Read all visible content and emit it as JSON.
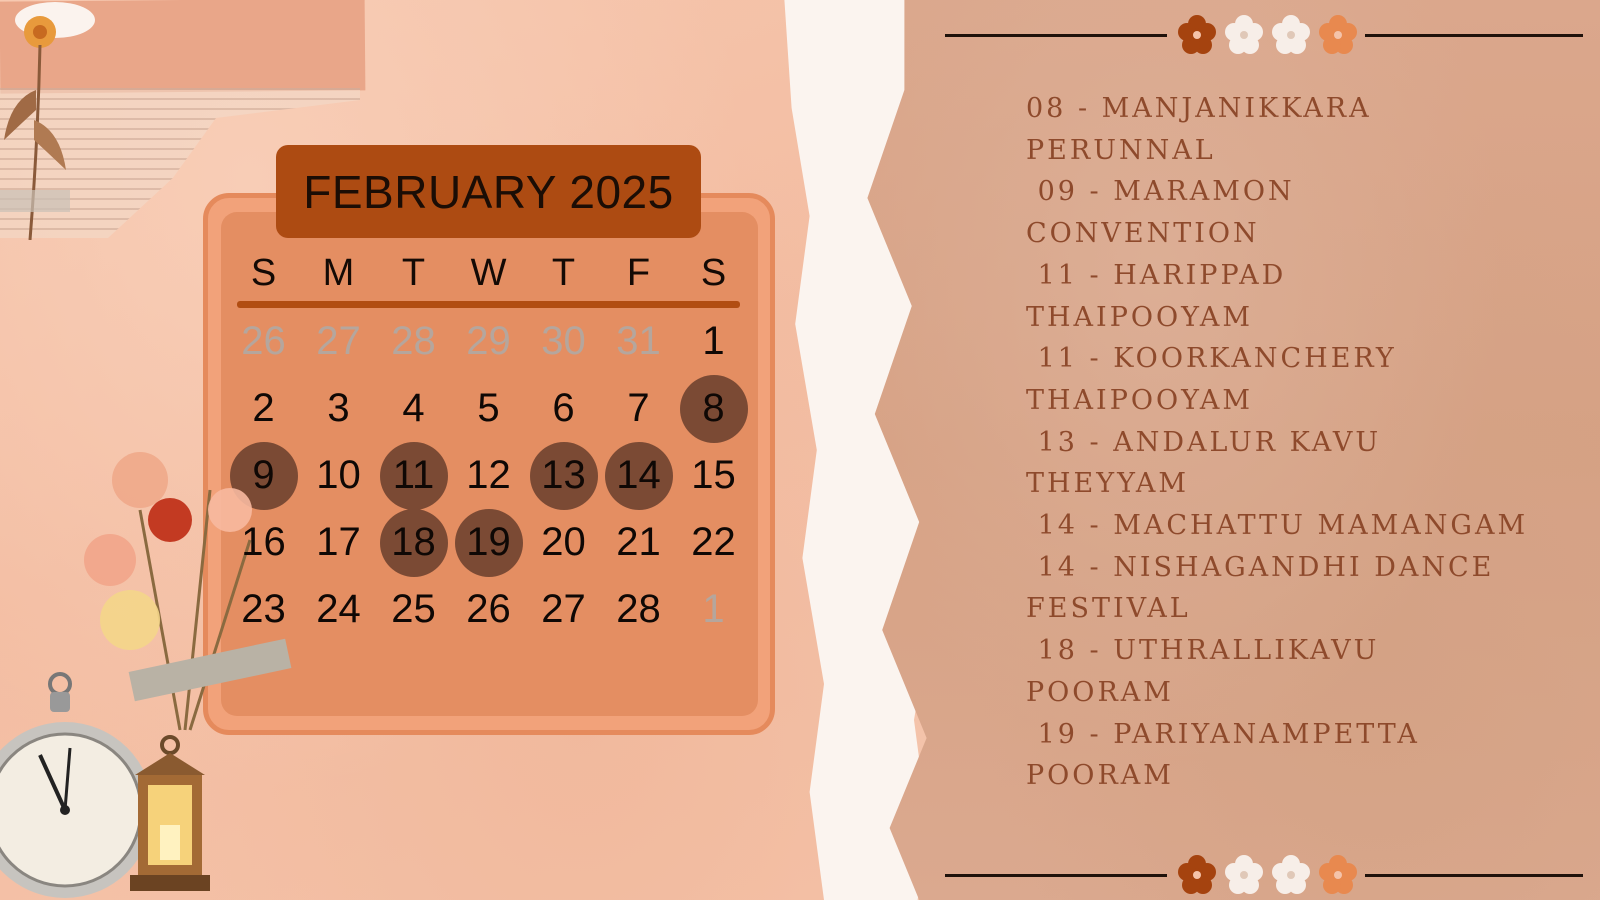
{
  "calendar": {
    "title": "FEBRUARY 2025",
    "weekdays": [
      "S",
      "M",
      "T",
      "W",
      "T",
      "F",
      "S"
    ],
    "highlighted_days": [
      8,
      9,
      11,
      13,
      14,
      18,
      19
    ],
    "highlight_color": "#7b4a34",
    "weeks": [
      [
        {
          "d": "26",
          "m": true
        },
        {
          "d": "27",
          "m": true
        },
        {
          "d": "28",
          "m": true
        },
        {
          "d": "29",
          "m": true
        },
        {
          "d": "30",
          "m": true
        },
        {
          "d": "31",
          "m": true
        },
        {
          "d": "1"
        }
      ],
      [
        {
          "d": "2"
        },
        {
          "d": "3"
        },
        {
          "d": "4"
        },
        {
          "d": "5"
        },
        {
          "d": "6"
        },
        {
          "d": "7"
        },
        {
          "d": "8",
          "h": true
        }
      ],
      [
        {
          "d": "9",
          "h": true
        },
        {
          "d": "10"
        },
        {
          "d": "11",
          "h": true
        },
        {
          "d": "12"
        },
        {
          "d": "13",
          "h": true
        },
        {
          "d": "14",
          "h": true
        },
        {
          "d": "15"
        }
      ],
      [
        {
          "d": "16"
        },
        {
          "d": "17"
        },
        {
          "d": "18",
          "h": true
        },
        {
          "d": "19",
          "h": true
        },
        {
          "d": "20"
        },
        {
          "d": "21"
        },
        {
          "d": "22"
        }
      ],
      [
        {
          "d": "23"
        },
        {
          "d": "24"
        },
        {
          "d": "25"
        },
        {
          "d": "26"
        },
        {
          "d": "27"
        },
        {
          "d": "28"
        },
        {
          "d": "1",
          "m": true
        }
      ]
    ]
  },
  "events": [
    "08 - MANJANIKKARA",
    "PERUNNAL",
    " 09 - MARAMON",
    "CONVENTION",
    " 11 - HARIPPAD",
    "THAIPOOYAM",
    " 11 - KOORKANCHERY",
    "THAIPOOYAM",
    " 13 - ANDALUR KAVU",
    "THEYYAM",
    " 14 - MACHATTU MAMANGAM",
    " 14 - NISHAGANDHI DANCE",
    "FESTIVAL",
    " 18 - UTHRALLIKAVU",
    "POORAM",
    " 19 - PARIYANAMPETTA",
    "POORAM"
  ],
  "colors": {
    "title_bg": "#ad4b12",
    "calendar_bg": "#e48e62",
    "events_text": "#8e4a2c"
  },
  "icons": [
    "flower-ornament-icon",
    "clock-icon",
    "lantern-icon",
    "dried-flower-bouquet-icon"
  ]
}
